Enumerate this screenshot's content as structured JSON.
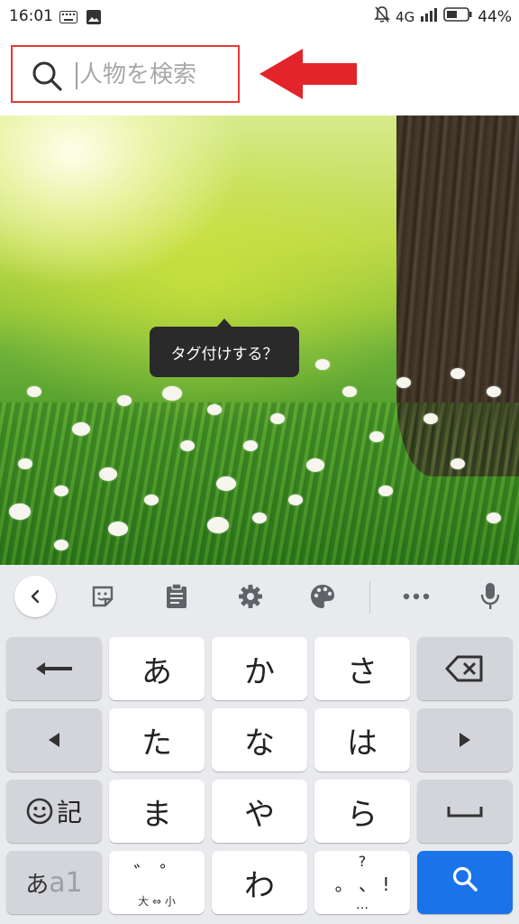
{
  "status_bar": {
    "time": "16:01",
    "network": "4G",
    "battery": "44%",
    "icons": [
      "keyboard-icon",
      "image-icon",
      "mute-icon",
      "signal-icon",
      "battery-icon"
    ]
  },
  "search": {
    "placeholder": "人物を検索",
    "value": "",
    "highlight_color": "#e53935"
  },
  "annotation": {
    "arrow_color": "#e3242b"
  },
  "photo": {
    "tooltip": "タグ付けする？"
  },
  "keyboard": {
    "toolbar": [
      "back-icon",
      "sticker-icon",
      "clipboard-icon",
      "settings-icon",
      "palette-icon",
      "more-icon",
      "microphone-icon"
    ],
    "rows": [
      [
        "↤",
        "あ",
        "か",
        "さ",
        "⌫"
      ],
      [
        "◀",
        "た",
        "な",
        "は",
        "▶"
      ],
      [
        "☺記",
        "ま",
        "や",
        "ら",
        "␣"
      ],
      [
        "あa1",
        "゛゜",
        "わ",
        "、。?!",
        "🔍"
      ]
    ],
    "keys": {
      "r1": {
        "k1": "あ",
        "k2": "か",
        "k3": "さ"
      },
      "r2": {
        "k1": "た",
        "k2": "な",
        "k3": "は"
      },
      "r3": {
        "k0_label": "記",
        "k1": "ま",
        "k2": "や",
        "k3": "ら"
      },
      "r4": {
        "k0_a": "あ",
        "k0_b": "a1",
        "k1_top": "゛ ゜",
        "k1_sub": "大 ⇔ 小",
        "k2": "わ",
        "k3_top": "?",
        "k3_mid": "。 、 !",
        "k3_bot": "…"
      }
    },
    "accent_color": "#1a73e8"
  }
}
